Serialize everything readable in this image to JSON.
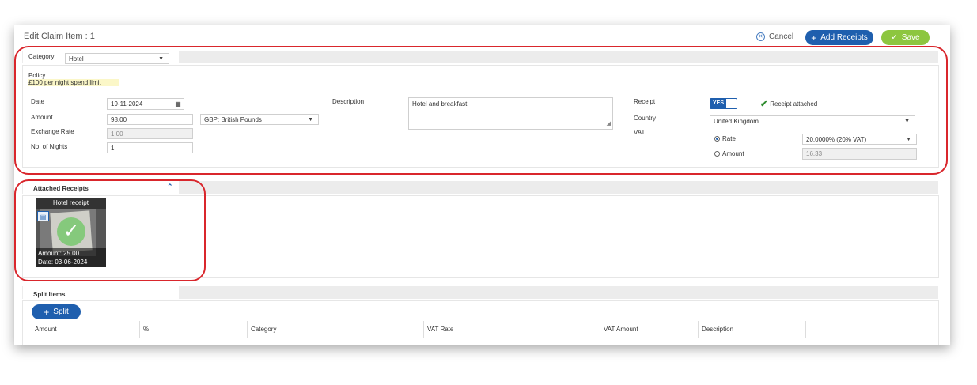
{
  "header": {
    "title": "Edit Claim Item : 1",
    "cancel_label": "Cancel",
    "add_receipts_label": "Add Receipts",
    "save_label": "Save"
  },
  "item": {
    "category_label": "Category",
    "category_value": "Hotel",
    "policy_label": "Policy",
    "policy_text": "£100 per night spend limit",
    "date_label": "Date",
    "date_value": "19-11-2024",
    "amount_label": "Amount",
    "amount_value": "98.00",
    "currency_value": "GBP: British Pounds",
    "exchange_rate_label": "Exchange Rate",
    "exchange_rate_value": "1.00",
    "nights_label": "No. of Nights",
    "nights_value": "1",
    "description_label": "Description",
    "description_value": "Hotel and breakfast",
    "receipt_label": "Receipt",
    "receipt_toggle": "YES",
    "receipt_status": "Receipt attached",
    "country_label": "Country",
    "country_value": "United Kingdom",
    "vat_label": "VAT",
    "vat_rate_option": "Rate",
    "vat_rate_value": "20.0000% (20% VAT)",
    "vat_amount_option": "Amount",
    "vat_amount_value": "16.33"
  },
  "receipts": {
    "section_title": "Attached Receipts",
    "card_title": "Hotel receipt",
    "card_amount": "Amount: 25.00",
    "card_date": "Date: 03-06-2024"
  },
  "split": {
    "section_title": "Split Items",
    "split_button": "Split",
    "columns": [
      "Amount",
      "%",
      "Category",
      "VAT Rate",
      "VAT Amount",
      "Description"
    ]
  },
  "colors": {
    "primary": "#1f5fae",
    "success": "#8dc63f",
    "highlight": "#d9262c",
    "check": "#2e8b2e"
  }
}
